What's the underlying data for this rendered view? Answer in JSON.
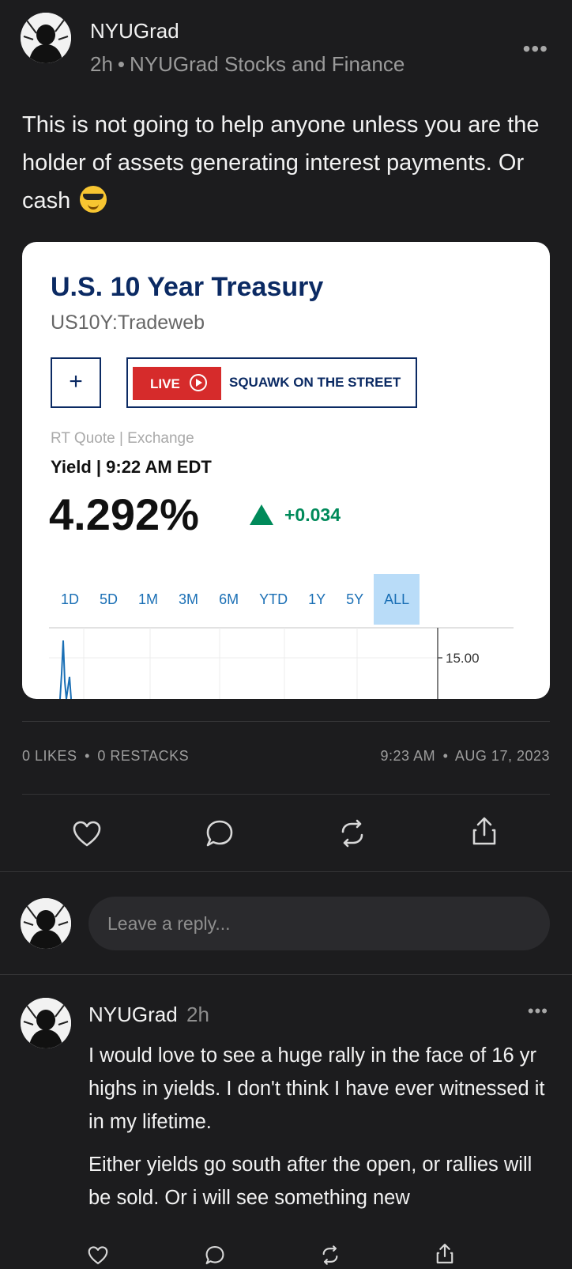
{
  "post": {
    "author": "NYUGrad",
    "time": "2h",
    "separator": "•",
    "community": "NYUGrad Stocks and Finance",
    "more_label": "•••",
    "text": "This is not going to help anyone unless you are the holder of assets generating interest payments. Or cash",
    "emoji": "smiling-face-with-sunglasses"
  },
  "quote_card": {
    "title": "U.S. 10 Year Treasury",
    "ticker": "US10Y:Tradeweb",
    "plus_label": "+",
    "live_label": "LIVE",
    "show_name": "SQUAWK ON THE STREET",
    "rt_quote": "RT Quote | Exchange",
    "yield_time": "Yield | 9:22 AM EDT",
    "price": "4.292%",
    "change": "+0.034",
    "change_direction": "up",
    "ranges": [
      "1D",
      "5D",
      "1M",
      "3M",
      "6M",
      "YTD",
      "1Y",
      "5Y",
      "ALL"
    ],
    "active_range": "ALL",
    "axis_label": "15.00"
  },
  "chart_data": {
    "type": "line",
    "title": "",
    "xlabel": "",
    "ylabel": "",
    "yticks": [
      "15.00"
    ],
    "note": "partially visible all-time yield chart, cropped"
  },
  "stats": {
    "likes": "0 LIKES",
    "separator": "•",
    "restacks": "0 RESTACKS",
    "time": "9:23 AM",
    "date": "AUG 17, 2023"
  },
  "actions": [
    "heart-icon",
    "comment-icon",
    "restack-icon",
    "share-icon"
  ],
  "reply": {
    "placeholder": "Leave a reply..."
  },
  "comment": {
    "author": "NYUGrad",
    "time": "2h",
    "more_label": "•••",
    "paragraph1": "I would love to see a huge rally in the face of 16 yr highs in yields. I don't think I have ever witnessed it in my lifetime.",
    "paragraph2": "Either yields go south after the open, or rallies will be sold. Or i will see something new"
  },
  "colors": {
    "background": "#1c1c1e",
    "card_title": "#0b2a63",
    "positive": "#008a5a",
    "live_red": "#d62b2b",
    "range_active_bg": "#b9dcf8"
  }
}
